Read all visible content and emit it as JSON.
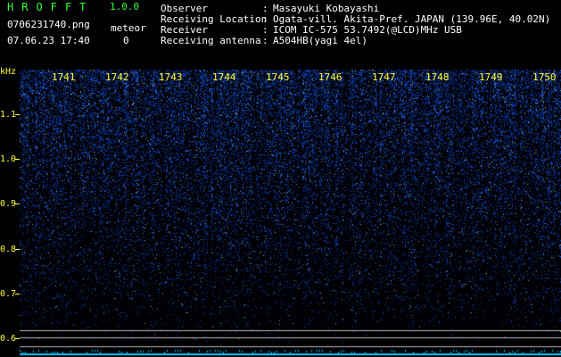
{
  "app": {
    "title": "HROFFT",
    "version": "1.0.0"
  },
  "file": {
    "name": "0706231740.png",
    "datetime": "07.06.23 17:40"
  },
  "meteor": {
    "label": "meteor",
    "count": "0"
  },
  "info": [
    {
      "label": "Observer",
      "value": "Masayuki Kobayashi"
    },
    {
      "label": "Receiving Location",
      "value": "Ogata-vill. Akita-Pref. JAPAN (139.96E, 40.02N)"
    },
    {
      "label": "Receiver",
      "value": "ICOM IC-575 53.7492(@LCD)MHz USB"
    },
    {
      "label": "Receiving antenna",
      "value": "A504HB(yagi 4el)"
    }
  ],
  "info_separator": ":",
  "axis": {
    "freq_unit": "kHz",
    "freq_ticks": [
      "1.1",
      "1.0",
      "0.9",
      "0.8",
      "0.7",
      "0.6"
    ],
    "time_ticks": [
      "1741",
      "1742",
      "1743",
      "1744",
      "1745",
      "1746",
      "1747",
      "1748",
      "1749",
      "1750"
    ]
  },
  "colors": {
    "title": "#33ff33",
    "axis": "#ffff33",
    "signal": "#1e3cff",
    "baseline": "#00c8ff"
  }
}
